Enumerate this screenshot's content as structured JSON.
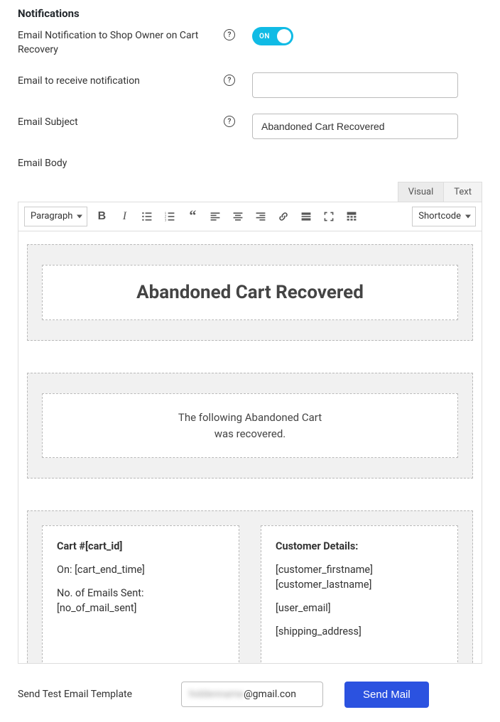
{
  "section_title": "Notifications",
  "rows": {
    "toggle": {
      "label": "Email Notification to Shop Owner on Cart Recovery",
      "state_label": "ON",
      "on": true
    },
    "recipient": {
      "label": "Email to receive notification",
      "value": ""
    },
    "subject": {
      "label": "Email Subject",
      "value": "Abandoned Cart Recovered"
    },
    "body": {
      "label": "Email Body"
    }
  },
  "editor": {
    "tabs": {
      "visual": "Visual",
      "text": "Text",
      "active": "visual"
    },
    "format_select": "Paragraph",
    "shortcode_select": "Shortcode",
    "content": {
      "heading": "Abandoned Cart Recovered",
      "intro_line1": "The following Abandoned Cart",
      "intro_line2": "was recovered.",
      "cart_col": {
        "title": "Cart #[cart_id]",
        "on_line": "On: [cart_end_time]",
        "emails_label": "No. of Emails Sent: [no_of_mail_sent]"
      },
      "customer_col": {
        "title": "Customer Details:",
        "name_line": "[customer_firstname] [customer_lastname]",
        "email_line": "[user_email]",
        "shipping_line": "[shipping_address]"
      }
    }
  },
  "send_test": {
    "label": "Send Test Email Template",
    "email_suffix": "@gmail.con",
    "button": "Send Mail"
  }
}
